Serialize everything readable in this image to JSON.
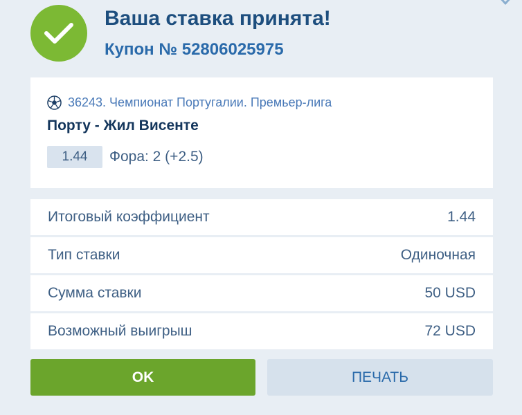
{
  "header": {
    "title": "Ваша ставка принята!",
    "coupon": "Купон № 52806025975"
  },
  "event": {
    "league": "36243. Чемпионат Португалии. Премьер-лига",
    "match": "Порту - Жил Висенте",
    "odds": "1.44",
    "bet": "Фора: 2 (+2.5)"
  },
  "summary": [
    {
      "label": "Итоговый коэффициент",
      "value": "1.44"
    },
    {
      "label": "Тип ставки",
      "value": "Одиночная"
    },
    {
      "label": "Сумма ставки",
      "value": "50 USD"
    },
    {
      "label": "Возможный выигрыш",
      "value": "72 USD"
    }
  ],
  "buttons": {
    "ok": "OK",
    "print": "ПЕЧАТЬ"
  },
  "colors": {
    "accent_green": "#7cb934",
    "button_green": "#6ba52c",
    "title_blue": "#1d4e7e",
    "link_blue": "#2a6aaa",
    "background": "#e8eef4"
  },
  "icons": {
    "status": "checkmark-icon",
    "sport": "soccer-ball-icon",
    "close": "close-icon"
  }
}
